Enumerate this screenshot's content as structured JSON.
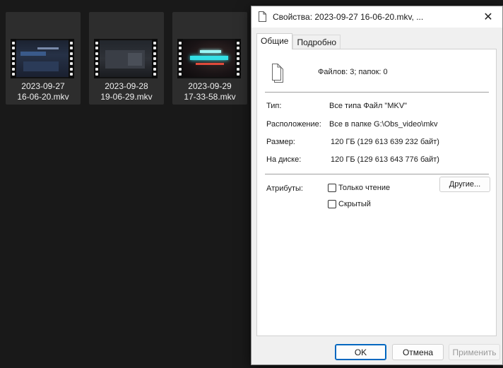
{
  "explorer": {
    "files": [
      {
        "name_line1": "2023-09-27",
        "name_line2": "16-06-20.mkv"
      },
      {
        "name_line1": "2023-09-28",
        "name_line2": "19-06-29.mkv"
      },
      {
        "name_line1": "2023-09-29",
        "name_line2": "17-33-58.mkv"
      }
    ]
  },
  "dialog": {
    "title": "Свойства: 2023-09-27 16-06-20.mkv, ...",
    "close_glyph": "✕",
    "tabs": [
      {
        "label": "Общие",
        "active": true
      },
      {
        "label": "Подробно",
        "active": false
      }
    ],
    "summary": "Файлов: 3; папок: 0",
    "properties": {
      "type_label": "Тип:",
      "type_value": "Все типа Файл \"MKV\"",
      "location_label": "Расположение:",
      "location_value": "Все в папке G:\\Obs_video\\mkv",
      "size_label": "Размер:",
      "size_value": "120 ГБ (129 613 639 232 байт)",
      "disk_label": "На диске:",
      "disk_value": "120 ГБ (129 613 643 776 байт)"
    },
    "attributes": {
      "label": "Атрибуты:",
      "readonly_label": "Только чтение",
      "readonly_checked": false,
      "hidden_label": "Скрытый",
      "hidden_checked": false,
      "other_button": "Другие..."
    },
    "buttons": {
      "ok": "OK",
      "cancel": "Отмена",
      "apply": "Применить"
    }
  }
}
